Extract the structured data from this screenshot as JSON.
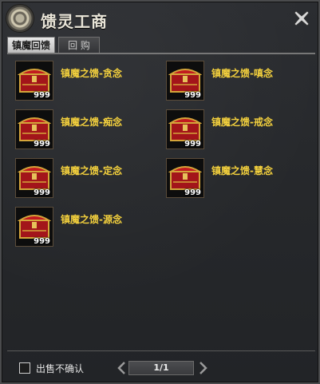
{
  "window": {
    "title": "馈灵工商"
  },
  "tabs": [
    {
      "label": "镇魔回馈",
      "active": true
    },
    {
      "label": "回 购",
      "active": false
    }
  ],
  "items": [
    {
      "name": "镇魔之馈-贪念",
      "qty": "999"
    },
    {
      "name": "镇魔之馈-嗔念",
      "qty": "999"
    },
    {
      "name": "镇魔之馈-痴念",
      "qty": "999"
    },
    {
      "name": "镇魔之馈-戒念",
      "qty": "999"
    },
    {
      "name": "镇魔之馈-定念",
      "qty": "999"
    },
    {
      "name": "镇魔之馈-慧念",
      "qty": "999"
    },
    {
      "name": "镇魔之馈-源念",
      "qty": "999"
    }
  ],
  "footer": {
    "confirm_label": "出售不确认",
    "page": "1/1"
  },
  "colors": {
    "item_name": "#f3d03d",
    "chest_red": "#b3151a",
    "chest_gold": "#d4a53a"
  },
  "icons": {
    "window": "gear-icon",
    "close": "close-icon",
    "chest": "treasure-chest-icon"
  }
}
